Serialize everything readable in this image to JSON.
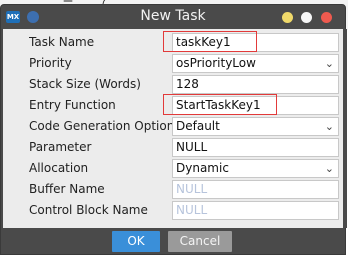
{
  "background": {
    "partial_text": "二 ...（ ..."
  },
  "window": {
    "logo": "MX",
    "title": "New Task"
  },
  "form": {
    "rows": [
      {
        "label": "Task Name",
        "value": "taskKey1",
        "type": "text"
      },
      {
        "label": "Priority",
        "value": "osPriorityLow",
        "type": "select"
      },
      {
        "label": "Stack Size (Words)",
        "value": "128",
        "type": "text"
      },
      {
        "label": "Entry Function",
        "value": "StartTaskKey1",
        "type": "text"
      },
      {
        "label": "Code Generation Option",
        "value": "Default",
        "type": "select"
      },
      {
        "label": "Parameter",
        "value": "NULL",
        "type": "text"
      },
      {
        "label": "Allocation",
        "value": "Dynamic",
        "type": "select"
      },
      {
        "label": "Buffer Name",
        "value": "NULL",
        "type": "placeholder"
      },
      {
        "label": "Control Block Name",
        "value": "NULL",
        "type": "placeholder"
      }
    ]
  },
  "buttons": {
    "ok": "OK",
    "cancel": "Cancel"
  },
  "colors": {
    "accent": "#3a8fd9",
    "highlight": "#e23a3a",
    "titlebar": "#4a4a4a"
  }
}
